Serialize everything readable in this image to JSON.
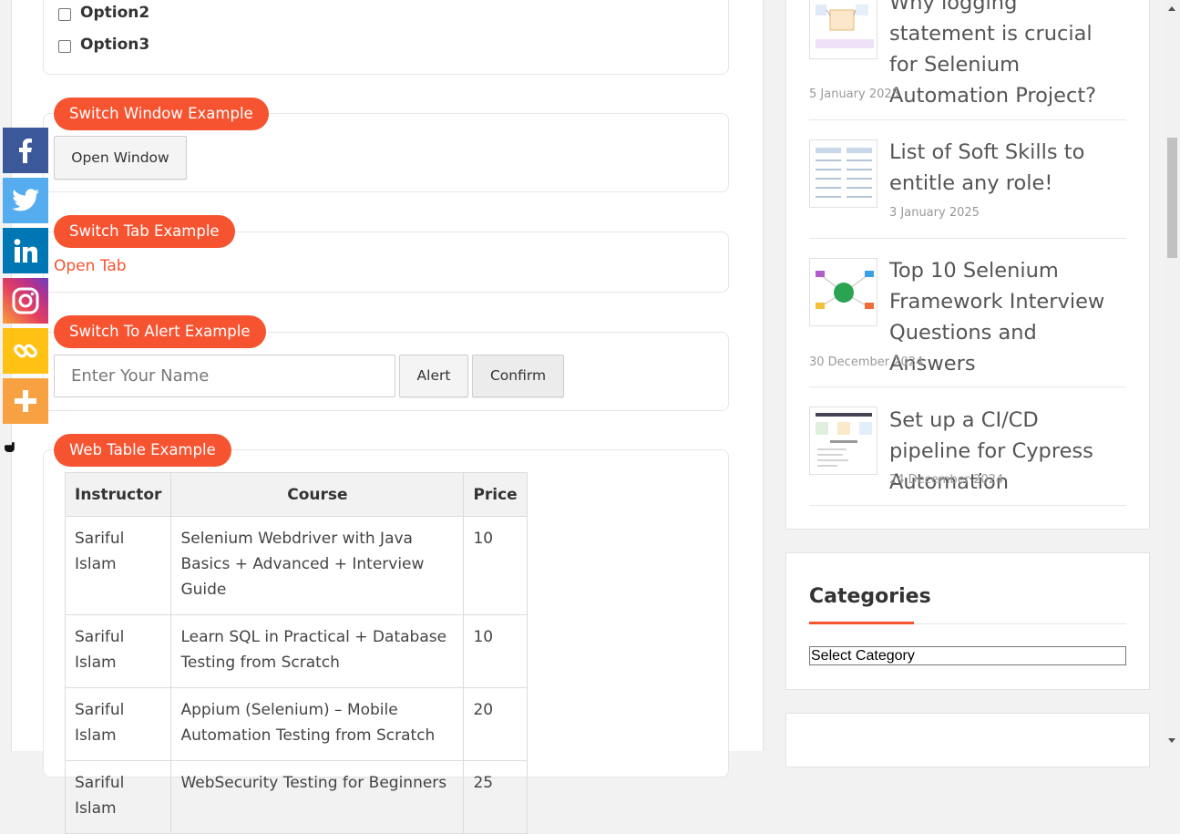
{
  "checkboxes": [
    {
      "label": "Option2",
      "checked": false
    },
    {
      "label": "Option3",
      "checked": false
    }
  ],
  "switch_window": {
    "legend": "Switch Window Example",
    "button": "Open Window"
  },
  "switch_tab": {
    "legend": "Switch Tab Example",
    "link": "Open Tab"
  },
  "alert": {
    "legend": "Switch To Alert Example",
    "placeholder": "Enter Your Name",
    "alert_button": "Alert",
    "confirm_button": "Confirm"
  },
  "web_table": {
    "legend": "Web Table Example",
    "headers": [
      "Instructor",
      "Course",
      "Price"
    ],
    "rows": [
      [
        "Sariful Islam",
        "Selenium Webdriver with Java Basics + Advanced + Interview Guide",
        "10"
      ],
      [
        "Sariful Islam",
        "Learn SQL in Practical + Database Testing from Scratch",
        "10"
      ],
      [
        "Sariful Islam",
        "Appium (Selenium) – Mobile Automation Testing from Scratch",
        "20"
      ],
      [
        "Sariful Islam",
        "WebSecurity Testing for Beginners",
        "25"
      ]
    ]
  },
  "social": [
    "facebook-icon",
    "twitter-icon",
    "linkedin-icon",
    "instagram-icon",
    "copy-link-icon",
    "more-icon"
  ],
  "colors": {
    "accent": "#f65331",
    "facebook": "#3b5998",
    "twitter": "#55acee",
    "linkedin": "#0077b5",
    "copylink": "#ffc112",
    "more": "#f8a142"
  },
  "recent_posts": [
    {
      "title": "Why logging statement is crucial for Selenium Automation Project?",
      "date": "5 January 2025"
    },
    {
      "title": "List of Soft Skills to entitle any role!",
      "date": "3 January 2025"
    },
    {
      "title": "Top 10 Selenium Framework Interview Questions and Answers",
      "date": "30 December 2024"
    },
    {
      "title": "Set up a CI/CD pipeline for Cypress Automation",
      "date": "24 December 2024"
    }
  ],
  "categories": {
    "heading": "Categories",
    "select": "Select Category"
  }
}
